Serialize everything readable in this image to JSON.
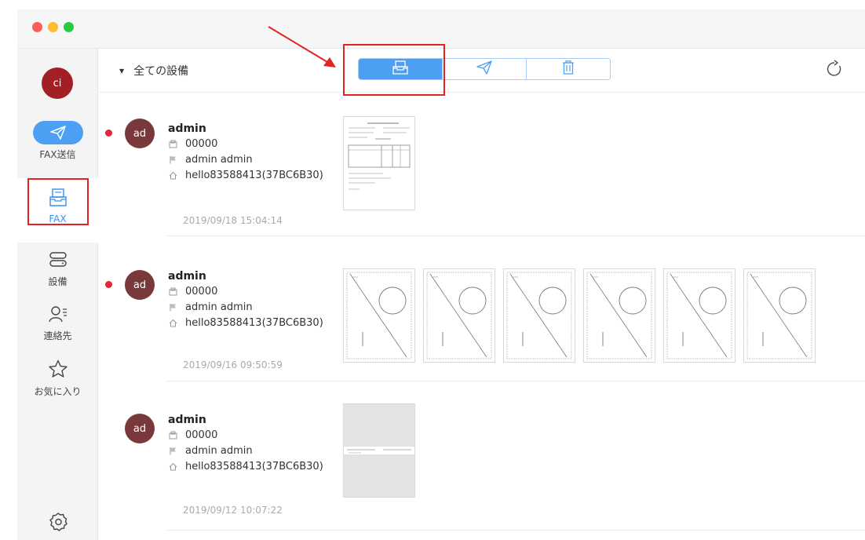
{
  "sidebar": {
    "user_initials": "ci",
    "fax_send_label": "FAX送信",
    "fax_label": "FAX",
    "devices_label": "設備",
    "contacts_label": "連絡先",
    "favorites_label": "お気に入り",
    "settings_label": "設定"
  },
  "toolbar": {
    "filter_label": "全ての設備",
    "tabs": [
      {
        "icon": "inbox-icon",
        "active": true
      },
      {
        "icon": "send-icon",
        "active": false
      },
      {
        "icon": "trash-icon",
        "active": false
      }
    ]
  },
  "faxes": [
    {
      "initials": "ad",
      "unread": true,
      "name": "admin",
      "fax_number": "00000",
      "sender_label": "admin admin",
      "device": "hello83588413(37BC6B30)",
      "timestamp": "2019/09/18 15:04:14",
      "page_count": 1
    },
    {
      "initials": "ad",
      "unread": true,
      "name": "admin",
      "fax_number": "00000",
      "sender_label": "admin admin",
      "device": "hello83588413(37BC6B30)",
      "timestamp": "2019/09/16 09:50:59",
      "page_count": 6
    },
    {
      "initials": "ad",
      "unread": false,
      "name": "admin",
      "fax_number": "00000",
      "sender_label": "admin admin",
      "device": "hello83588413(37BC6B30)",
      "timestamp": "2019/09/12 10:07:22",
      "page_count": 1
    }
  ],
  "colors": {
    "accent": "#4c9ff3",
    "user_avatar": "#a31f26",
    "sender_avatar": "#79383a",
    "unread_dot": "#e2263a",
    "annotation": "#e02424"
  }
}
